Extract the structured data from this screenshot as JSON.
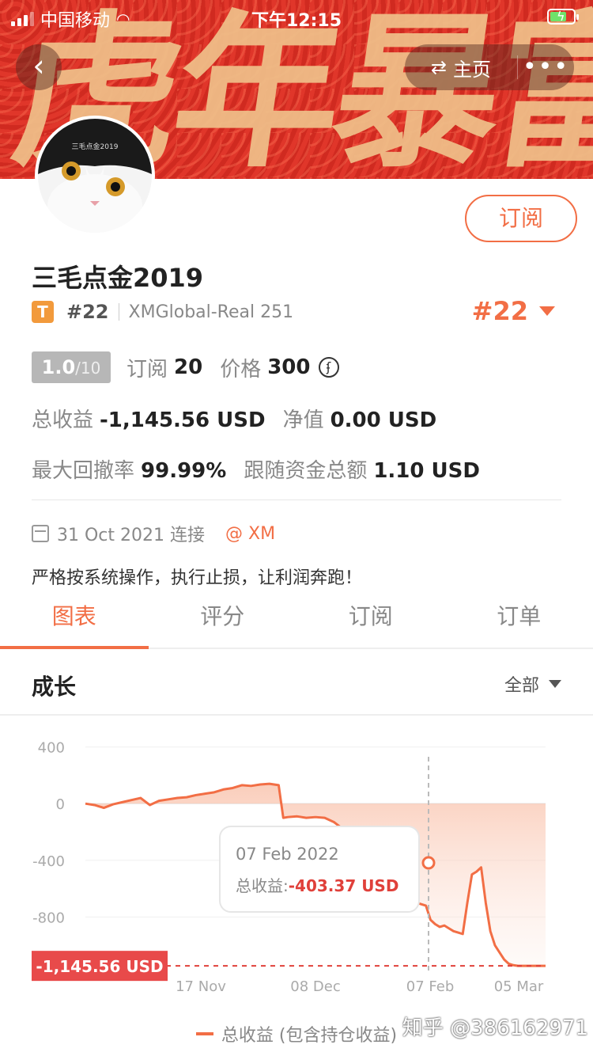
{
  "status_bar": {
    "carrier": "中国移动",
    "time": "下午12:15"
  },
  "banner": {
    "text": "虎年暴富"
  },
  "nav": {
    "home_label": "主页",
    "more_label": "•••"
  },
  "profile": {
    "name": "三毛点金2019",
    "avatar_caption": "三毛点金2019",
    "tier_badge": "T",
    "rank": "#22",
    "account": "XMGlobal-Real 251",
    "rank_big": "#22",
    "subscribe_label": "订阅"
  },
  "stats": {
    "score": "1.0",
    "score_den": "/10",
    "subscribers_label": "订阅",
    "subscribers": "20",
    "price_label": "价格",
    "price": "300",
    "coin_symbol": "ʄ",
    "total_profit_label": "总收益",
    "total_profit": "-1,145.56 USD",
    "net_value_label": "净值",
    "net_value": "0.00 USD",
    "max_drawdown_label": "最大回撤率",
    "max_drawdown": "99.99%",
    "follow_funds_label": "跟随资金总额",
    "follow_funds": "1.10 USD"
  },
  "connection": {
    "date": "31 Oct 2021 连接",
    "broker": "@ XM"
  },
  "motto": "严格按系统操作，执行止损，让利润奔跑！",
  "tabs": [
    {
      "label": "图表"
    },
    {
      "label": "评分"
    },
    {
      "label": "订阅"
    },
    {
      "label": "订单"
    }
  ],
  "growth": {
    "title": "成长",
    "filter": "全部"
  },
  "chart_data": {
    "type": "area",
    "yticks": [
      "400",
      "0",
      "-400",
      "-800"
    ],
    "xticks": [
      "17 Nov",
      "08 Dec",
      "07 Feb",
      "05 Mar"
    ],
    "ylim": [
      -1200,
      420
    ],
    "current_value_label": "-1,145.56 USD",
    "tooltip": {
      "date": "07 Feb 2022",
      "label": "总收益:",
      "value": "-403.37 USD"
    },
    "series": [
      {
        "name": "总收益 (包含持仓收益)",
        "x": [
          0,
          2,
          4,
          6,
          8,
          10,
          12,
          14,
          16,
          18,
          20,
          22,
          24,
          26,
          28,
          30,
          32,
          34,
          36,
          38,
          40,
          42,
          43,
          44,
          46,
          48,
          50,
          52,
          54,
          56,
          58,
          60,
          62,
          63,
          64,
          65,
          66,
          67,
          68,
          69,
          70,
          72,
          74,
          75,
          76,
          77,
          78,
          79,
          80,
          81,
          82,
          83,
          84,
          85,
          86,
          87,
          88,
          89,
          90,
          91,
          92,
          93,
          94,
          95,
          96,
          97,
          98,
          99,
          100
        ],
        "values": [
          0,
          -10,
          -30,
          -5,
          10,
          25,
          40,
          -10,
          20,
          30,
          40,
          45,
          60,
          70,
          80,
          100,
          110,
          130,
          125,
          135,
          140,
          130,
          -100,
          -95,
          -90,
          -100,
          -95,
          -100,
          -130,
          -180,
          -220,
          -250,
          -300,
          -400,
          -390,
          -420,
          -380,
          -300,
          -250,
          -400,
          -560,
          -700,
          -720,
          -820,
          -850,
          -870,
          -860,
          -880,
          -900,
          -910,
          -920,
          -700,
          -500,
          -480,
          -450,
          -700,
          -900,
          -1000,
          -1050,
          -1100,
          -1130,
          -1140,
          -1145,
          -1145,
          -1145,
          -1145,
          -1145,
          -1145,
          -1145
        ]
      }
    ]
  },
  "legend": {
    "series_label": "总收益 (包含持仓收益)"
  },
  "watermark": "知乎 @386162971"
}
